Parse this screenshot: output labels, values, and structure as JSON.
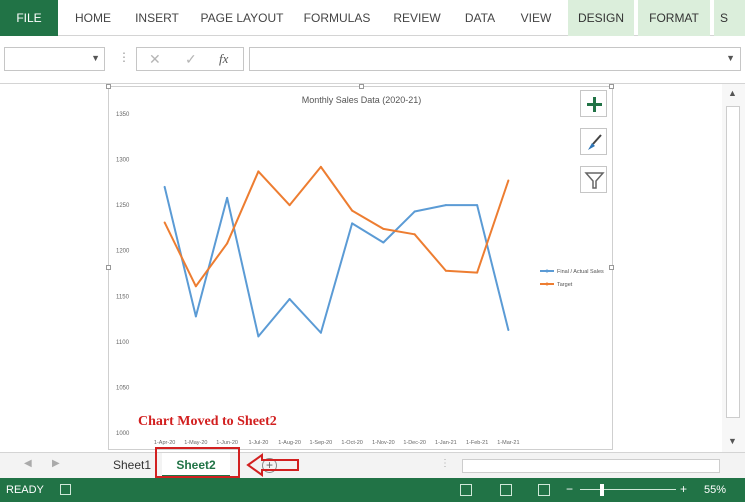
{
  "ribbon": {
    "tabs": [
      "FILE",
      "HOME",
      "INSERT",
      "PAGE LAYOUT",
      "FORMULAS",
      "REVIEW",
      "DATA",
      "VIEW",
      "DESIGN",
      "FORMAT",
      "S"
    ]
  },
  "formula_bar": {
    "cancel_icon": "✕",
    "enter_icon": "✓",
    "fx_label": "fx"
  },
  "chart_data": {
    "type": "line",
    "title": "Monthly Sales Data (2020-21)",
    "categories": [
      "1-Apr-20",
      "1-May-20",
      "1-Jun-20",
      "1-Jul-20",
      "1-Aug-20",
      "1-Sep-20",
      "1-Oct-20",
      "1-Nov-20",
      "1-Dec-20",
      "1-Jan-21",
      "1-Feb-21",
      "1-Mar-21"
    ],
    "series": [
      {
        "name": "Final / Actual Sales",
        "color": "#5b9bd5",
        "values": [
          1270,
          1128,
          1258,
          1106,
          1147,
          1110,
          1230,
          1209,
          1243,
          1250,
          1250,
          1113
        ]
      },
      {
        "name": "Target",
        "color": "#ed7d31",
        "values": [
          1231,
          1161,
          1208,
          1287,
          1250,
          1292,
          1244,
          1224,
          1218,
          1178,
          1176,
          1277
        ]
      }
    ],
    "yticks": [
      "1000",
      "1050",
      "1100",
      "1150",
      "1200",
      "1250",
      "1300",
      "1350"
    ],
    "ylim": [
      1000,
      1350
    ],
    "legend_position": "right"
  },
  "caption": "Chart Moved to Sheet2",
  "sheet_tabs": [
    "Sheet1",
    "Sheet2"
  ],
  "status": {
    "ready": "READY",
    "zoom": "55%"
  },
  "colors": {
    "accent": "#217346",
    "annotation": "#d22020"
  }
}
